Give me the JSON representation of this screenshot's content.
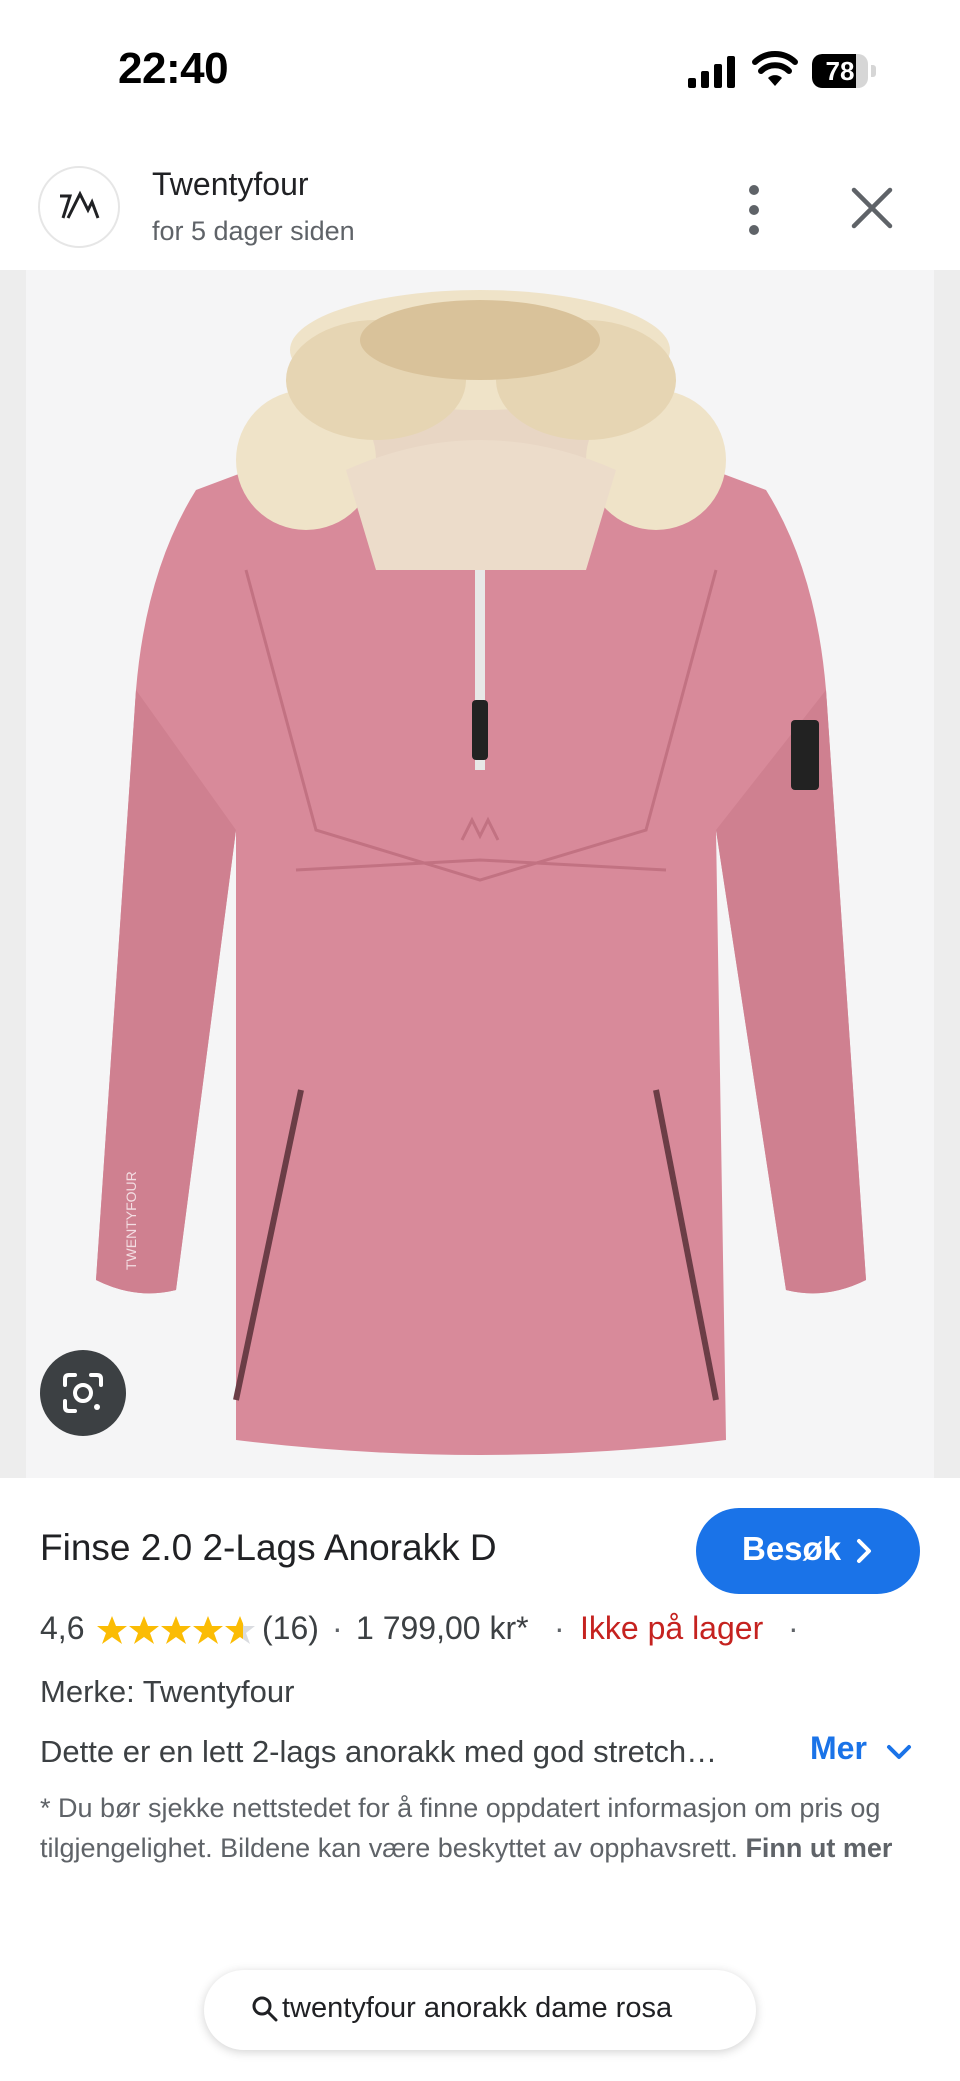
{
  "status_bar": {
    "time": "22:40",
    "battery": "78",
    "battery_level": 0.78
  },
  "header": {
    "site_name": "Twentyfour",
    "posted": "for 5 dager siden"
  },
  "product": {
    "title": "Finse 2.0 2-Lags Anorakk D",
    "visit_label": "Besøk",
    "rating": "4,6",
    "rating_value": 4.6,
    "review_count": "(16)",
    "price": "1 799,00 kr*",
    "availability": "Ikke på lager",
    "separator": "·",
    "brand": "Merke: Twentyfour",
    "description": "Dette er en lett 2-lags anorakk med god stretch…",
    "more_label": "Mer",
    "disclaimer": "* Du bør sjekke nettstedet for å finne oppdatert informasjon om pris og tilgjengelighet. Bildene kan være beskyttet av opphavsrett.",
    "learn_more": "Finn ut mer"
  },
  "jacket_labels": {
    "sleeve_print": "TWENTYFOUR"
  },
  "search": {
    "query": "twentyfour anorakk dame rosa"
  },
  "colors": {
    "accent": "#1a73e8",
    "out_of_stock": "#c5221f",
    "star": "#fbbc04",
    "jacket": "#d88a9a"
  },
  "icons": [
    "signal-icon",
    "wifi-icon",
    "battery-icon",
    "more-vert-icon",
    "close-icon",
    "lens-icon",
    "chevron-right-icon",
    "star-icon",
    "chevron-down-icon",
    "search-icon"
  ]
}
